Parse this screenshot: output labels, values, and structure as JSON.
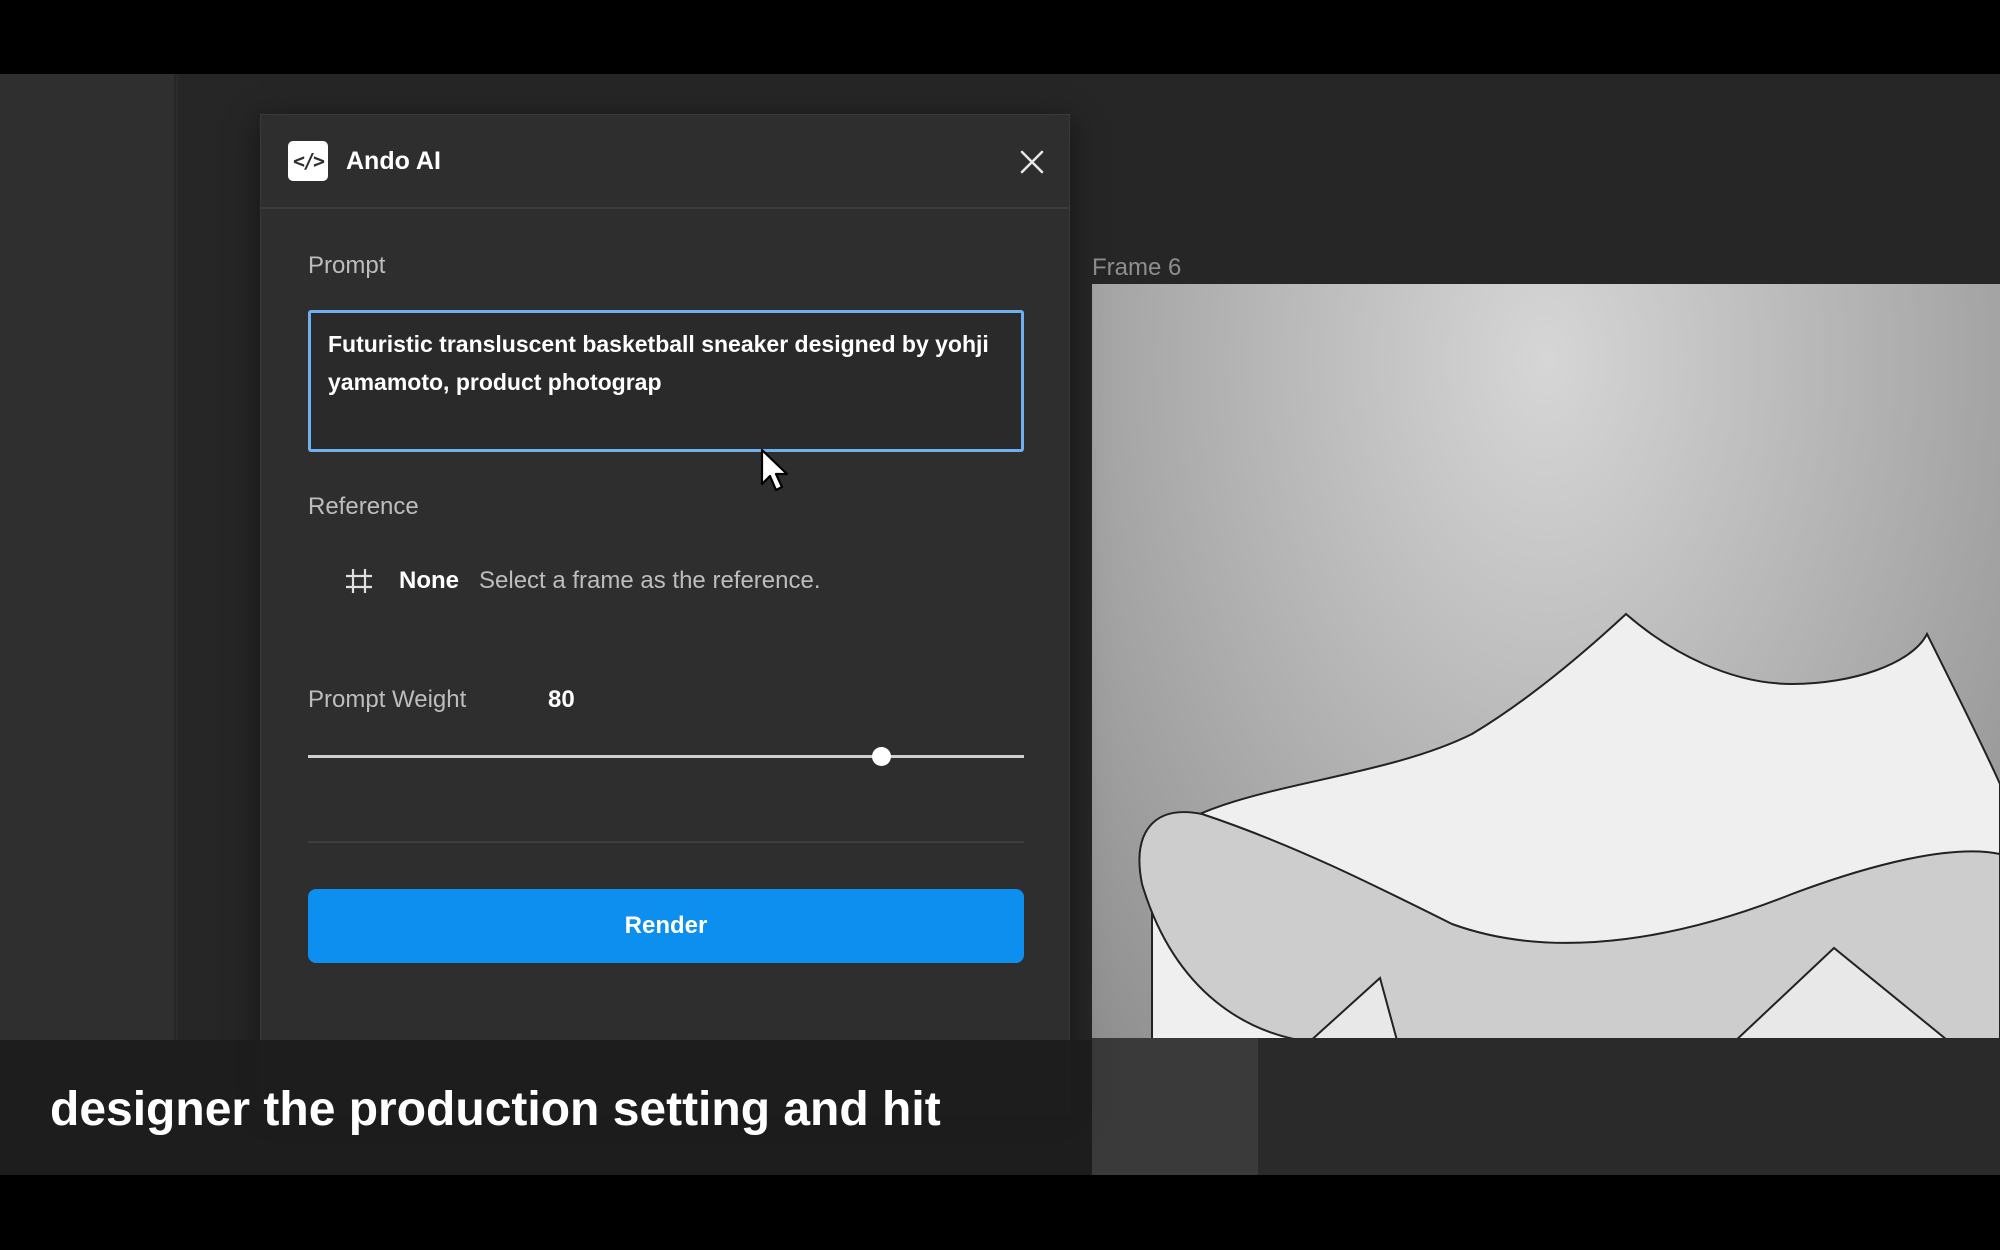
{
  "panel": {
    "title": "Ando AI",
    "logo_glyph": "</>",
    "icons": {
      "logo": "code-brackets-icon",
      "close": "close-icon",
      "reference": "hash-frame-icon",
      "cursor": "mouse-pointer-icon"
    }
  },
  "prompt": {
    "label": "Prompt",
    "value": "Futuristic transluscent basketball sneaker designed by yohji yamamoto, product photograp"
  },
  "reference": {
    "label": "Reference",
    "value": "None",
    "hint": "Select a frame as the reference."
  },
  "weight": {
    "label": "Prompt Weight",
    "value": "80",
    "slider_fraction": 0.8
  },
  "render": {
    "label": "Render"
  },
  "canvas": {
    "frame_label": "Frame 6"
  },
  "caption": {
    "text": "designer the production setting and hit"
  },
  "colors": {
    "accent": "#0d8ff0",
    "focus_border": "#6fb1f0",
    "panel_bg": "#2e2e2e",
    "canvas_bg": "#262626"
  }
}
